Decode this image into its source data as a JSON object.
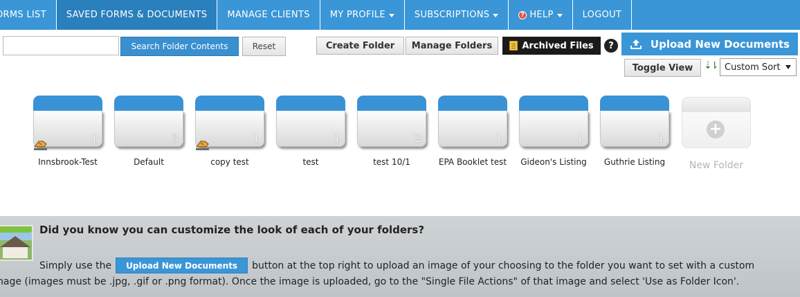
{
  "nav": {
    "items": [
      {
        "label": "ORMS LIST"
      },
      {
        "label": "SAVED FORMS & DOCUMENTS"
      },
      {
        "label": "MANAGE CLIENTS"
      },
      {
        "label": "MY PROFILE"
      },
      {
        "label": "SUBSCRIPTIONS"
      },
      {
        "label": "HELP"
      },
      {
        "label": "LOGOUT"
      }
    ]
  },
  "toolbar": {
    "search_value": "",
    "search_button": "Search Folder Contents",
    "reset_button": "Reset",
    "create_folder": "Create Folder",
    "manage_folders": "Manage Folders",
    "archived_files": "Archived Files",
    "help_symbol": "?",
    "upload_button": "Upload New Documents",
    "toggle_view": "Toggle View",
    "sort_value": "Custom Sort"
  },
  "folders": [
    {
      "name": "Innsbrook-Test",
      "count": "1",
      "shared": true
    },
    {
      "name": "Default",
      "count": "3",
      "shared": false
    },
    {
      "name": "copy test",
      "count": "1",
      "shared": true
    },
    {
      "name": "test",
      "count": "1",
      "shared": false
    },
    {
      "name": "test 10/1",
      "count": "2",
      "shared": false
    },
    {
      "name": "EPA Booklet test",
      "count": "1",
      "shared": false
    },
    {
      "name": "Gideon's Listing",
      "count": "1",
      "shared": false
    },
    {
      "name": "Guthrie Listing",
      "count": "1",
      "shared": false
    }
  ],
  "new_folder": {
    "label": "New Folder",
    "plus": "+"
  },
  "info": {
    "title": "Did you know you can customize the look of each of your folders?",
    "line1_before": "Simply use the",
    "line1_button": "Upload New Documents",
    "line1_after": "button at the top right to upload an image of your choosing to the folder you want to set with a custom",
    "line2": "nage (images must be .jpg, .gif or .png format). Once the image is uploaded, go to the \"Single File Actions\" of that image and select 'Use as Folder Icon'."
  },
  "colors": {
    "nav_blue": "#3a96d6",
    "nav_active": "#2a7fbd",
    "folder_tab": "#3a92d6",
    "archived_bg": "#1a1a1a",
    "info_bg": "#c6cacd"
  },
  "icons": {
    "upload": "upload-icon",
    "help": "help-icon",
    "sort": "sort-icon",
    "shared": "shared-hand-icon",
    "archive": "document-icon"
  }
}
